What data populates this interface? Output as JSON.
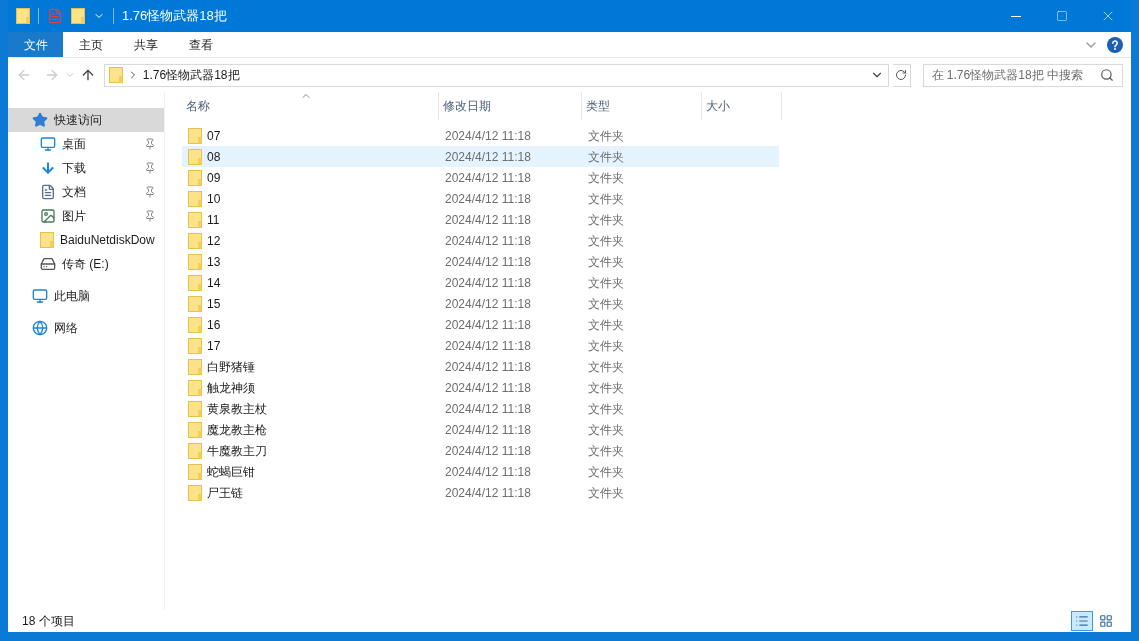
{
  "window": {
    "title": "1.76怪物武器18把"
  },
  "ribbon_tabs": [
    {
      "label": "文件",
      "selected": true
    },
    {
      "label": "主页",
      "selected": false
    },
    {
      "label": "共享",
      "selected": false
    },
    {
      "label": "查看",
      "selected": false
    }
  ],
  "address": {
    "path": "1.76怪物武器18把"
  },
  "search": {
    "placeholder": "在 1.76怪物武器18把 中搜索"
  },
  "sidebar": {
    "items": [
      {
        "label": "快速访问",
        "kind": "star",
        "selected": true,
        "pinned": false,
        "children": [
          {
            "label": "桌面",
            "kind": "desktop",
            "selected": false,
            "pinned": true
          },
          {
            "label": "下载",
            "kind": "download",
            "selected": false,
            "pinned": true
          },
          {
            "label": "文档",
            "kind": "document",
            "selected": false,
            "pinned": true
          },
          {
            "label": "图片",
            "kind": "picture",
            "selected": false,
            "pinned": true
          },
          {
            "label": "BaiduNetdiskDow",
            "kind": "folder",
            "selected": false,
            "pinned": false
          },
          {
            "label": "传奇 (E:)",
            "kind": "drive",
            "selected": false,
            "pinned": false
          }
        ]
      },
      {
        "label": "此电脑",
        "kind": "pc",
        "selected": false,
        "pinned": false
      },
      {
        "label": "网络",
        "kind": "network",
        "selected": false,
        "pinned": false
      }
    ]
  },
  "table": {
    "columns": [
      "名称",
      "修改日期",
      "类型",
      "大小"
    ],
    "rows": [
      {
        "name": "07",
        "date": "2024/4/12 11:18",
        "type": "文件夹",
        "selected": false
      },
      {
        "name": "08",
        "date": "2024/4/12 11:18",
        "type": "文件夹",
        "selected": true
      },
      {
        "name": "09",
        "date": "2024/4/12 11:18",
        "type": "文件夹",
        "selected": false
      },
      {
        "name": "10",
        "date": "2024/4/12 11:18",
        "type": "文件夹",
        "selected": false
      },
      {
        "name": "11",
        "date": "2024/4/12 11:18",
        "type": "文件夹",
        "selected": false
      },
      {
        "name": "12",
        "date": "2024/4/12 11:18",
        "type": "文件夹",
        "selected": false
      },
      {
        "name": "13",
        "date": "2024/4/12 11:18",
        "type": "文件夹",
        "selected": false
      },
      {
        "name": "14",
        "date": "2024/4/12 11:18",
        "type": "文件夹",
        "selected": false
      },
      {
        "name": "15",
        "date": "2024/4/12 11:18",
        "type": "文件夹",
        "selected": false
      },
      {
        "name": "16",
        "date": "2024/4/12 11:18",
        "type": "文件夹",
        "selected": false
      },
      {
        "name": "17",
        "date": "2024/4/12 11:18",
        "type": "文件夹",
        "selected": false
      },
      {
        "name": "白野猪锤",
        "date": "2024/4/12 11:18",
        "type": "文件夹",
        "selected": false
      },
      {
        "name": "触龙神须",
        "date": "2024/4/12 11:18",
        "type": "文件夹",
        "selected": false
      },
      {
        "name": "黄泉教主杖",
        "date": "2024/4/12 11:18",
        "type": "文件夹",
        "selected": false
      },
      {
        "name": "魔龙教主枪",
        "date": "2024/4/12 11:18",
        "type": "文件夹",
        "selected": false
      },
      {
        "name": "牛魔教主刀",
        "date": "2024/4/12 11:18",
        "type": "文件夹",
        "selected": false
      },
      {
        "name": "蛇蝎巨钳",
        "date": "2024/4/12 11:18",
        "type": "文件夹",
        "selected": false
      },
      {
        "name": "尸王链",
        "date": "2024/4/12 11:18",
        "type": "文件夹",
        "selected": false
      }
    ]
  },
  "status_bar": {
    "count": "18 个项目",
    "views": [
      {
        "kind": "details",
        "selected": true
      },
      {
        "kind": "thumbnails",
        "selected": false
      }
    ]
  }
}
